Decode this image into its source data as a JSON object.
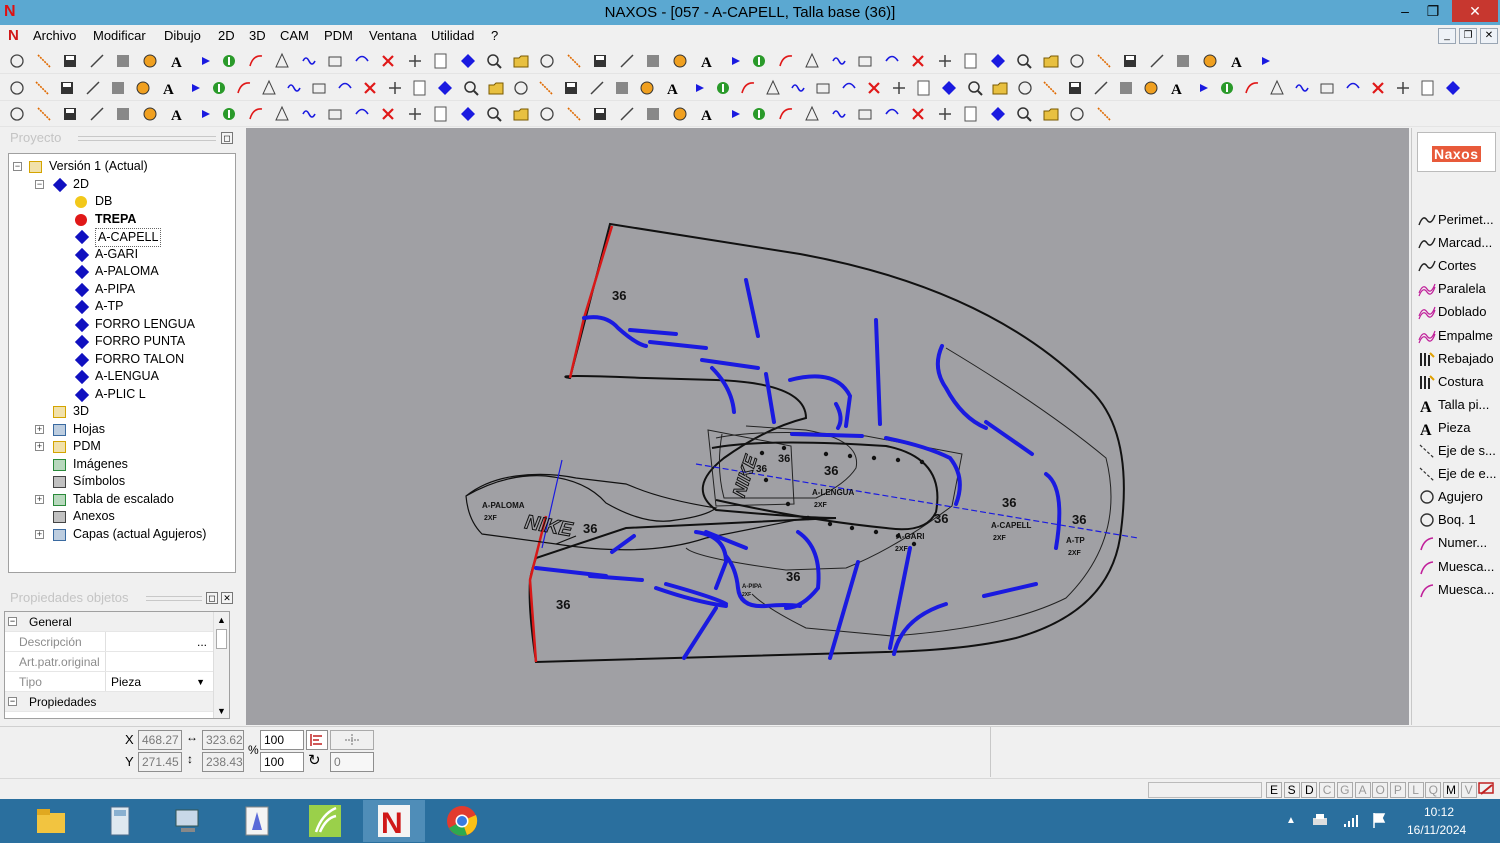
{
  "window": {
    "title": "NAXOS - [057 - A-CAPELL, Talla base (36)]",
    "min": "‒",
    "max": "❐",
    "close": "✕"
  },
  "menu": [
    "Archivo",
    "Modificar",
    "Dibujo",
    "2D",
    "3D",
    "CAM",
    "PDM",
    "Ventana",
    "Utilidad",
    "?"
  ],
  "mdi_buttons": [
    "_",
    "❐",
    "✕"
  ],
  "project": {
    "header": "Proyecto",
    "tree": [
      {
        "label": "Versión 1 (Actual)",
        "level": 0,
        "expander": "−",
        "icon": "version-icon",
        "color": "#d4a400"
      },
      {
        "label": "2D",
        "level": 1,
        "expander": "−",
        "icon": "2d-icon",
        "color": "#1010c0"
      },
      {
        "label": "DB",
        "level": 2,
        "expander": "",
        "icon": "yellow-dot-icon",
        "color": "#f2c81a"
      },
      {
        "label": "TREPA",
        "level": 2,
        "expander": "",
        "icon": "red-dot-icon",
        "color": "#e01818",
        "bold": true
      },
      {
        "label": "A-CAPELL",
        "level": 2,
        "expander": "",
        "icon": "piece-icon",
        "color": "#1010c0",
        "selected": true
      },
      {
        "label": "A-GARI",
        "level": 2,
        "expander": "",
        "icon": "piece-icon",
        "color": "#1010c0"
      },
      {
        "label": "A-PALOMA",
        "level": 2,
        "expander": "",
        "icon": "piece-icon",
        "color": "#1010c0"
      },
      {
        "label": "A-PIPA",
        "level": 2,
        "expander": "",
        "icon": "piece-icon",
        "color": "#1010c0"
      },
      {
        "label": "A-TP",
        "level": 2,
        "expander": "",
        "icon": "piece-icon",
        "color": "#1010c0"
      },
      {
        "label": "FORRO LENGUA",
        "level": 2,
        "expander": "",
        "icon": "piece-icon",
        "color": "#1010c0"
      },
      {
        "label": "FORRO PUNTA",
        "level": 2,
        "expander": "",
        "icon": "piece-icon",
        "color": "#1010c0"
      },
      {
        "label": "FORRO TALON",
        "level": 2,
        "expander": "",
        "icon": "piece-icon",
        "color": "#1010c0"
      },
      {
        "label": "A-LENGUA",
        "level": 2,
        "expander": "",
        "icon": "piece-icon",
        "color": "#1010c0"
      },
      {
        "label": "A-PLIC L",
        "level": 2,
        "expander": "",
        "icon": "piece-icon",
        "color": "#1010c0"
      },
      {
        "label": "3D",
        "level": 1,
        "expander": "",
        "icon": "3d-icon",
        "color": "#d4a400"
      },
      {
        "label": "Hojas",
        "level": 1,
        "expander": "+",
        "icon": "sheets-icon",
        "color": "#3a6aa0"
      },
      {
        "label": "PDM",
        "level": 1,
        "expander": "+",
        "icon": "folder-icon",
        "color": "#d4a400"
      },
      {
        "label": "Imágenes",
        "level": 1,
        "expander": "",
        "icon": "images-icon",
        "color": "#2a8a3a"
      },
      {
        "label": "Símbolos",
        "level": 1,
        "expander": "",
        "icon": "symbols-icon",
        "color": "#444444"
      },
      {
        "label": "Tabla de escalado",
        "level": 1,
        "expander": "+",
        "icon": "table-icon",
        "color": "#2a8a3a"
      },
      {
        "label": "Anexos",
        "level": 1,
        "expander": "",
        "icon": "paperclip-icon",
        "color": "#444444"
      },
      {
        "label": "Capas (actual Agujeros)",
        "level": 1,
        "expander": "+",
        "icon": "layers-icon",
        "color": "#3a6aa0"
      }
    ]
  },
  "properties": {
    "header": "Propiedades objetos",
    "rows": [
      {
        "type": "cat",
        "label": "General"
      },
      {
        "type": "prop",
        "label": "Descripción",
        "value": "",
        "button": "..."
      },
      {
        "type": "prop",
        "label": "Art.patr.original",
        "value": ""
      },
      {
        "type": "prop",
        "label": "Tipo",
        "value": "Pieza",
        "dropdown": true
      },
      {
        "type": "cat",
        "label": "Propiedades"
      }
    ]
  },
  "canvas": {
    "labels": [
      {
        "text": "36",
        "kind": "size"
      },
      {
        "text": "36",
        "kind": "size"
      },
      {
        "text": "36",
        "kind": "size"
      },
      {
        "text": "36",
        "kind": "size"
      },
      {
        "text": "36",
        "kind": "size"
      },
      {
        "text": "36",
        "kind": "size"
      },
      {
        "text": "36",
        "kind": "size"
      },
      {
        "text": "36",
        "kind": "size"
      },
      {
        "text": "36",
        "kind": "size"
      },
      {
        "text": "36",
        "kind": "size"
      },
      {
        "text": "A-PALOMA",
        "kind": "piece"
      },
      {
        "text": "2XF",
        "kind": "piece"
      },
      {
        "text": "A-LENGUA",
        "kind": "piece"
      },
      {
        "text": "2XF",
        "kind": "piece"
      },
      {
        "text": "A-CAPELL",
        "kind": "piece"
      },
      {
        "text": "2XF",
        "kind": "piece"
      },
      {
        "text": "A-TP",
        "kind": "piece"
      },
      {
        "text": "2XF",
        "kind": "piece"
      },
      {
        "text": "A-GARI",
        "kind": "piece"
      },
      {
        "text": "2XF",
        "kind": "piece"
      },
      {
        "text": "A-PIPA",
        "kind": "piece"
      },
      {
        "text": "2XF",
        "kind": "piece"
      },
      {
        "text": "NIKE",
        "kind": "logo"
      },
      {
        "text": "NIKE",
        "kind": "logo"
      }
    ]
  },
  "right_panel": {
    "brand": "Naxos",
    "tools": [
      {
        "label": "Perimet...",
        "icon": "perimeter-icon"
      },
      {
        "label": "Marcad...",
        "icon": "marking-icon"
      },
      {
        "label": "Cortes",
        "icon": "cuts-icon"
      },
      {
        "label": "Paralela",
        "icon": "parallel-icon"
      },
      {
        "label": "Doblado",
        "icon": "fold-icon"
      },
      {
        "label": "Empalme",
        "icon": "join-icon"
      },
      {
        "label": "Rebajado",
        "icon": "skive-icon"
      },
      {
        "label": "Costura",
        "icon": "seam-icon"
      },
      {
        "label": "Talla pi...",
        "icon": "text-size-icon"
      },
      {
        "label": "Pieza",
        "icon": "text-piece-icon"
      },
      {
        "label": "Eje de s...",
        "icon": "axis-icon"
      },
      {
        "label": "Eje de e...",
        "icon": "axis-icon"
      },
      {
        "label": "Agujero",
        "icon": "hole-icon"
      },
      {
        "label": "Boq. 1",
        "icon": "hole-icon"
      },
      {
        "label": "Numer...",
        "icon": "number-icon"
      },
      {
        "label": "Muesca...",
        "icon": "notch-icon"
      },
      {
        "label": "Muesca...",
        "icon": "notch-icon"
      }
    ]
  },
  "coords": {
    "x_label": "X",
    "y_label": "Y",
    "x": "468.27",
    "y": "271.45",
    "width": "323.62",
    "height": "238.43",
    "scale_x": "100",
    "scale_y": "100",
    "percent": "%",
    "rotation": "0"
  },
  "status_flags": [
    {
      "letter": "E",
      "on": true
    },
    {
      "letter": "S",
      "on": true
    },
    {
      "letter": "D",
      "on": true
    },
    {
      "letter": "C",
      "on": false
    },
    {
      "letter": "G",
      "on": false
    },
    {
      "letter": "A",
      "on": false
    },
    {
      "letter": "O",
      "on": false
    },
    {
      "letter": "P",
      "on": false
    },
    {
      "letter": "L",
      "on": false
    },
    {
      "letter": "Q",
      "on": false
    },
    {
      "letter": "M",
      "on": true
    },
    {
      "letter": "V",
      "on": false
    }
  ],
  "taskbar": {
    "apps": [
      {
        "name": "file-explorer-icon",
        "active": false
      },
      {
        "name": "calculator-icon",
        "active": false
      },
      {
        "name": "network-computer-icon",
        "active": false
      },
      {
        "name": "design-app-icon",
        "active": false
      },
      {
        "name": "green-app-icon",
        "active": false
      },
      {
        "name": "naxos-icon",
        "active": true
      },
      {
        "name": "chrome-icon",
        "active": false
      }
    ],
    "time": "10:12",
    "date": "16/11/2024"
  }
}
